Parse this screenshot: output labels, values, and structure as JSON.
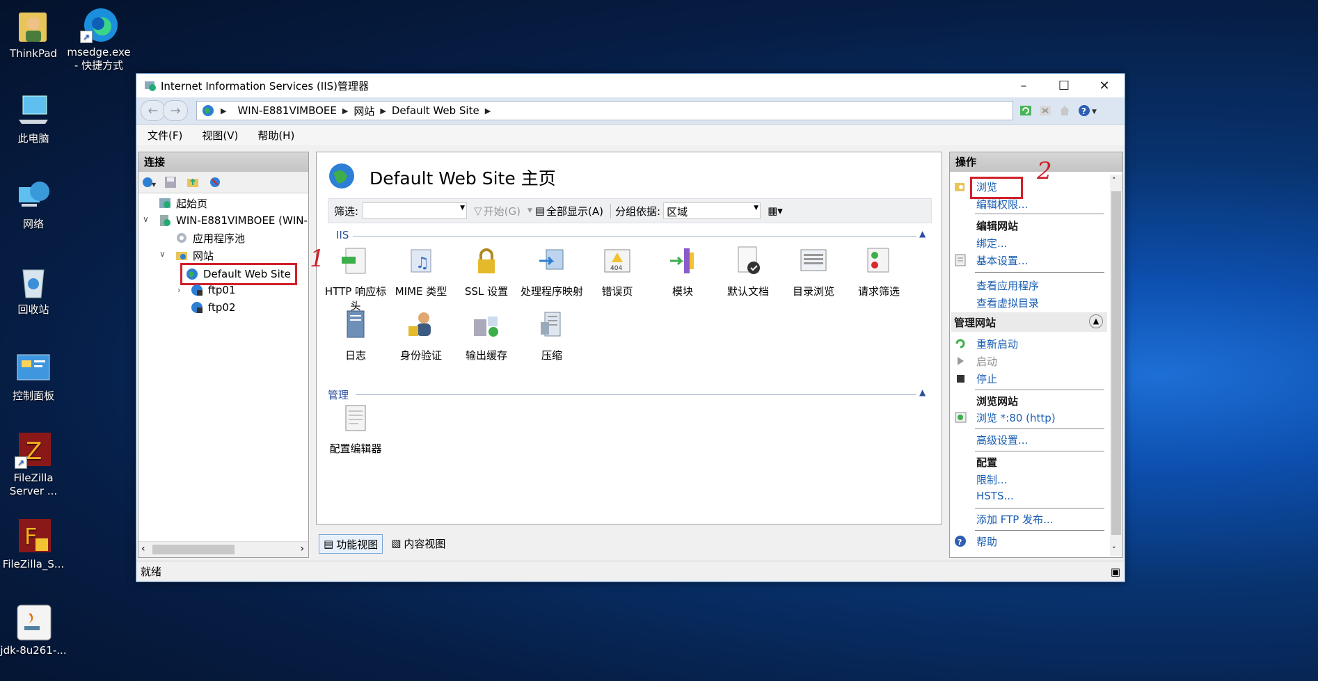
{
  "desktop": {
    "icons": [
      {
        "label": "ThinkPad",
        "icon": "user-folder-icon"
      },
      {
        "label": "msedge.exe - 快捷方式",
        "icon": "edge-icon"
      },
      {
        "label": "此电脑",
        "icon": "computer-icon"
      },
      {
        "label": "网络",
        "icon": "network-icon"
      },
      {
        "label": "回收站",
        "icon": "recycle-bin-icon"
      },
      {
        "label": "控制面板",
        "icon": "control-panel-icon"
      },
      {
        "label": "FileZilla Server ...",
        "icon": "filezilla-server-icon"
      },
      {
        "label": "FileZilla_S...",
        "icon": "filezilla-setup-icon"
      },
      {
        "label": "jdk-8u261-...",
        "icon": "java-installer-icon"
      }
    ]
  },
  "window": {
    "title": "Internet Information Services (IIS)管理器",
    "address": [
      "WIN-E881VIMBOEE",
      "网站",
      "Default Web Site"
    ],
    "menu": [
      "文件(F)",
      "视图(V)",
      "帮助(H)"
    ],
    "status": "就绪"
  },
  "connections": {
    "header": "连接",
    "tree": {
      "start_page": "起始页",
      "server": "WIN-E881VIMBOEE (WIN-",
      "app_pools": "应用程序池",
      "sites": "网站",
      "default_site": "Default Web Site",
      "ftp01": "ftp01",
      "ftp02": "ftp02"
    }
  },
  "main": {
    "title": "Default Web Site 主页",
    "filter": {
      "label": "筛选:",
      "start": "开始(G)",
      "show_all": "全部显示(A)",
      "group_by_label": "分组依据:",
      "group_by_value": "区域"
    },
    "iis_group": "IIS",
    "iis_features": [
      {
        "label": "HTTP 响应标头",
        "icon": "http-response-headers-icon"
      },
      {
        "label": "MIME 类型",
        "icon": "mime-types-icon"
      },
      {
        "label": "SSL 设置",
        "icon": "ssl-lock-icon"
      },
      {
        "label": "处理程序映射",
        "icon": "handler-mappings-icon"
      },
      {
        "label": "错误页",
        "icon": "error-pages-icon"
      },
      {
        "label": "模块",
        "icon": "modules-icon"
      },
      {
        "label": "默认文档",
        "icon": "default-document-icon"
      },
      {
        "label": "目录浏览",
        "icon": "directory-browsing-icon"
      },
      {
        "label": "请求筛选",
        "icon": "request-filtering-icon"
      },
      {
        "label": "日志",
        "icon": "logging-icon"
      },
      {
        "label": "身份验证",
        "icon": "authentication-icon"
      },
      {
        "label": "输出缓存",
        "icon": "output-caching-icon"
      },
      {
        "label": "压缩",
        "icon": "compression-icon"
      }
    ],
    "mgmt_group": "管理",
    "mgmt_features": [
      {
        "label": "配置编辑器",
        "icon": "configuration-editor-icon"
      }
    ],
    "tabs": {
      "features_view": "功能视图",
      "content_view": "内容视图"
    }
  },
  "actions": {
    "header": "操作",
    "explore": "浏览",
    "edit_permissions": "编辑权限...",
    "edit_site": "编辑网站",
    "bindings": "绑定...",
    "basic_settings": "基本设置...",
    "view_apps": "查看应用程序",
    "view_vdirs": "查看虚拟目录",
    "manage_site": "管理网站",
    "restart": "重新启动",
    "start": "启动",
    "stop": "停止",
    "browse_site": "浏览网站",
    "browse_80": "浏览 *:80 (http)",
    "advanced_settings": "高级设置...",
    "configure": "配置",
    "limits": "限制...",
    "hsts": "HSTS...",
    "add_ftp": "添加 FTP 发布...",
    "help": "帮助"
  },
  "annotations": {
    "one": "1",
    "two": "2"
  }
}
